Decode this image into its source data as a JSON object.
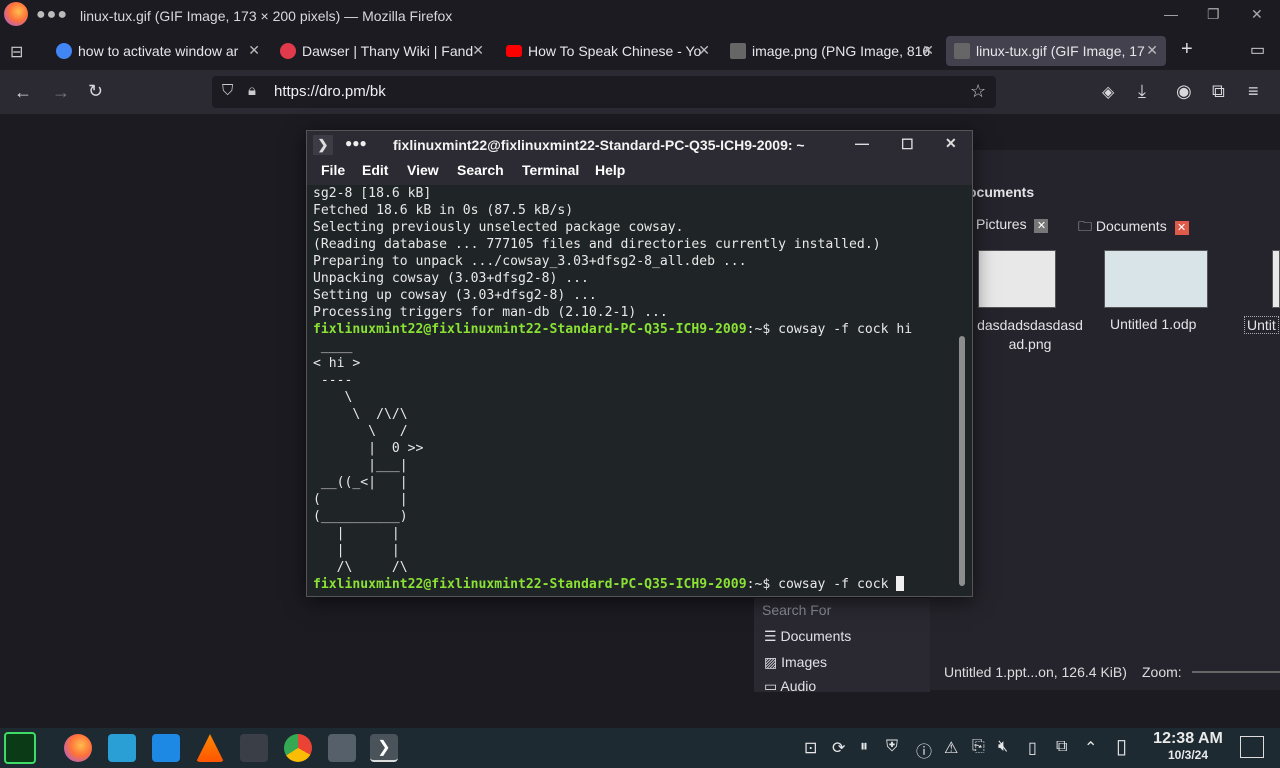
{
  "firefox": {
    "window_title": "linux-tux.gif (GIF Image, 173 × 200 pixels) — Mozilla Firefox",
    "tabs": [
      {
        "label": "how to activate window ar",
        "icon": "google-icon",
        "color": "#4285f4"
      },
      {
        "label": "Dawser | Thany Wiki | Fand",
        "icon": "fandom-icon",
        "color": "#e13a4c"
      },
      {
        "label": "How To Speak Chinese - Yo",
        "icon": "youtube-icon",
        "color": "#ff0000"
      },
      {
        "label": "image.png (PNG Image, 816",
        "icon": "image-icon",
        "color": "#888888"
      },
      {
        "label": "linux-tux.gif (GIF Image, 17",
        "icon": "image-icon",
        "color": "#888888"
      }
    ],
    "url": "https://dro.pm/bk"
  },
  "terminal": {
    "title": "fixlinuxmint22@fixlinuxmint22-Standard-PC-Q35-ICH9-2009: ~",
    "menu": [
      "File",
      "Edit",
      "View",
      "Search",
      "Terminal",
      "Help"
    ],
    "lines": [
      "sg2-8 [18.6 kB]",
      "Fetched 18.6 kB in 0s (87.5 kB/s)",
      "Selecting previously unselected package cowsay.",
      "(Reading database ... 777105 files and directories currently installed.)",
      "Preparing to unpack .../cowsay_3.03+dfsg2-8_all.deb ...",
      "Unpacking cowsay (3.03+dfsg2-8) ...",
      "Setting up cowsay (3.03+dfsg2-8) ...",
      "Processing triggers for man-db (2.10.2-1) ..."
    ],
    "prompt": "fixlinuxmint22@fixlinuxmint22-Standard-PC-Q35-ICH9-2009",
    "cmd1": ":~$ cowsay -f cock hi",
    "cow_art": [
      " ____",
      "< hi >",
      " ----",
      "    \\",
      "     \\  /\\/\\",
      "       \\   /",
      "       |  0 >>",
      "       |___|",
      " __((_<|   |",
      "(          |",
      "(__________)",
      "   |      |",
      "   |      |",
      "   /\\     /\\"
    ],
    "cmd2": ":~$ cowsay -f cock "
  },
  "file_manager": {
    "header": "ocuments",
    "tab_pictures": "Pictures",
    "tab_documents": "Documents",
    "files": [
      {
        "name": "dasdadsdasdasd\nad.png"
      },
      {
        "name": "Untitled 1.odp"
      },
      {
        "name": "Untit"
      }
    ],
    "search_for": "Search For",
    "search_items": [
      "Documents",
      "Images",
      "Audio"
    ],
    "status": "Untitled 1.ppt...on, 126.4 KiB)",
    "zoom_label": "Zoom:"
  },
  "taskbar": {
    "time": "12:38 AM",
    "date": "10/3/24"
  }
}
